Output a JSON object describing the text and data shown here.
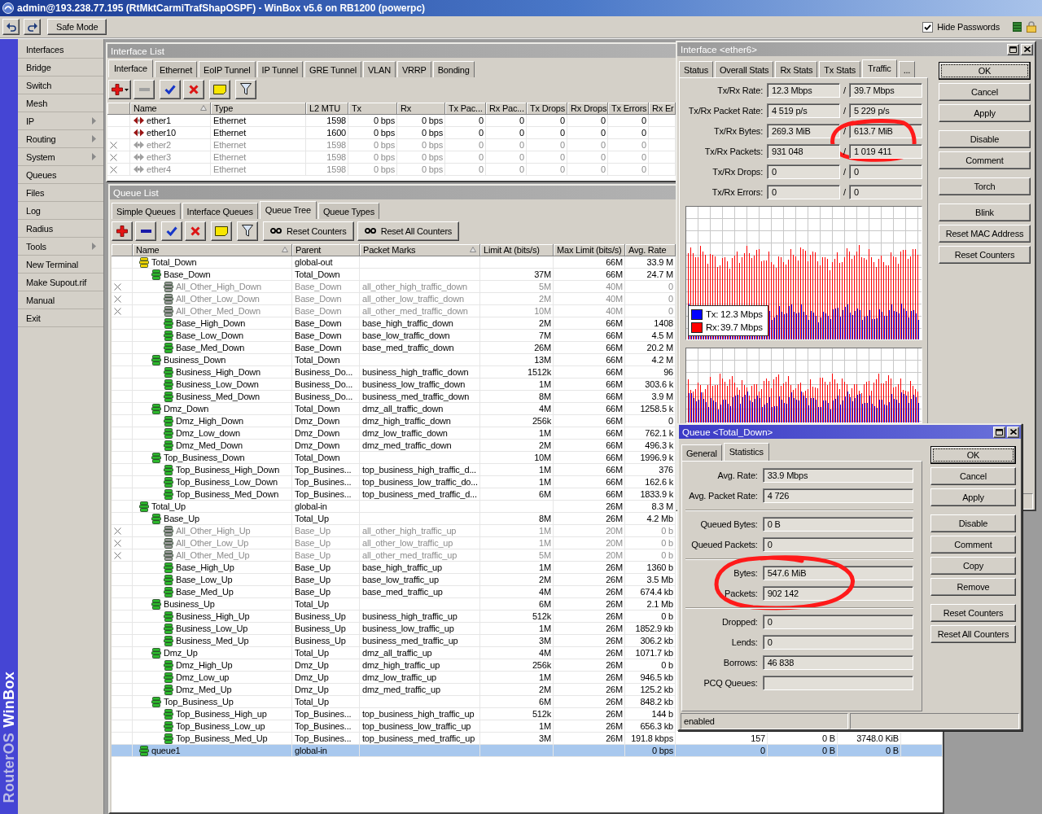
{
  "title_bar": {
    "title": "admin@193.238.77.195 (RtMktCarmiTrafShapOSPF) - WinBox v5.6 on RB1200 (powerpc)"
  },
  "toolbar": {
    "safe_mode": "Safe Mode",
    "hide_passwords": {
      "label": "Hide Passwords",
      "checked": true
    }
  },
  "side_strip": {
    "brand": "RouterOS",
    "product": "WinBox"
  },
  "sidebar": {
    "items": [
      {
        "label": "Interfaces",
        "submenu": false,
        "selected": false
      },
      {
        "label": "Bridge",
        "submenu": false,
        "selected": false
      },
      {
        "label": "Switch",
        "submenu": false,
        "selected": false
      },
      {
        "label": "Mesh",
        "submenu": false,
        "selected": false
      },
      {
        "label": "IP",
        "submenu": true,
        "selected": false
      },
      {
        "label": "Routing",
        "submenu": true,
        "selected": false
      },
      {
        "label": "System",
        "submenu": true,
        "selected": false
      },
      {
        "label": "Queues",
        "submenu": false,
        "selected": false
      },
      {
        "label": "Files",
        "submenu": false,
        "selected": false
      },
      {
        "label": "Log",
        "submenu": false,
        "selected": false
      },
      {
        "label": "Radius",
        "submenu": false,
        "selected": false
      },
      {
        "label": "Tools",
        "submenu": true,
        "selected": false
      },
      {
        "label": "New Terminal",
        "submenu": false,
        "selected": false
      },
      {
        "label": "Make Supout.rif",
        "submenu": false,
        "selected": false
      },
      {
        "label": "Manual",
        "submenu": false,
        "selected": false
      },
      {
        "label": "Exit",
        "submenu": false,
        "selected": false
      }
    ]
  },
  "interface_list": {
    "title": "Interface List",
    "tabs": [
      {
        "label": "Interface",
        "selected": true
      },
      {
        "label": "Ethernet",
        "selected": false
      },
      {
        "label": "EoIP Tunnel",
        "selected": false
      },
      {
        "label": "IP Tunnel",
        "selected": false
      },
      {
        "label": "GRE Tunnel",
        "selected": false
      },
      {
        "label": "VLAN",
        "selected": false
      },
      {
        "label": "VRRP",
        "selected": false
      },
      {
        "label": "Bonding",
        "selected": false
      }
    ],
    "tools": [
      {
        "kind": "add_menu",
        "disabled": false
      },
      {
        "kind": "remove",
        "disabled": true
      },
      {
        "kind": "enable",
        "disabled": false
      },
      {
        "kind": "disable",
        "disabled": false
      },
      {
        "kind": "comment",
        "disabled": false
      },
      {
        "kind": "filter",
        "disabled": false
      }
    ],
    "columns": [
      {
        "label": "Name",
        "sorted": true
      },
      {
        "label": "Type",
        "sorted": false
      },
      {
        "label": "L2 MTU",
        "sorted": false
      },
      {
        "label": "Tx",
        "sorted": false
      },
      {
        "label": "Rx",
        "sorted": false
      },
      {
        "label": "Tx Pac...",
        "sorted": false
      },
      {
        "label": "Rx Pac...",
        "sorted": false
      },
      {
        "label": "Tx Drops",
        "sorted": false
      },
      {
        "label": "Rx Drops",
        "sorted": false
      },
      {
        "label": "Tx Errors",
        "sorted": false
      },
      {
        "label": "Rx Er",
        "sorted": false
      }
    ],
    "rows": [
      {
        "disabled": false,
        "selected": false,
        "cells": [
          "ether1",
          "Ethernet",
          "1598",
          "0 bps",
          "0 bps",
          "0",
          "0",
          "0",
          "0",
          "0"
        ]
      },
      {
        "disabled": false,
        "selected": false,
        "cells": [
          "ether10",
          "Ethernet",
          "1600",
          "0 bps",
          "0 bps",
          "0",
          "0",
          "0",
          "0",
          "0"
        ]
      },
      {
        "disabled": true,
        "selected": false,
        "cells": [
          "ether2",
          "Ethernet",
          "1598",
          "0 bps",
          "0 bps",
          "0",
          "0",
          "0",
          "0",
          "0"
        ]
      },
      {
        "disabled": true,
        "selected": false,
        "cells": [
          "ether3",
          "Ethernet",
          "1598",
          "0 bps",
          "0 bps",
          "0",
          "0",
          "0",
          "0",
          "0"
        ]
      },
      {
        "disabled": true,
        "selected": false,
        "cells": [
          "ether4",
          "Ethernet",
          "1598",
          "0 bps",
          "0 bps",
          "0",
          "0",
          "0",
          "0",
          "0"
        ]
      }
    ]
  },
  "queue_list": {
    "title": "Queue List",
    "tabs": [
      {
        "label": "Simple Queues",
        "selected": false
      },
      {
        "label": "Interface Queues",
        "selected": false
      },
      {
        "label": "Queue Tree",
        "selected": true
      },
      {
        "label": "Queue Types",
        "selected": false
      }
    ],
    "tools": [
      {
        "kind": "add",
        "disabled": false
      },
      {
        "kind": "remove",
        "disabled": false
      },
      {
        "kind": "enable",
        "disabled": false
      },
      {
        "kind": "disable",
        "disabled": false
      },
      {
        "kind": "comment",
        "disabled": false
      },
      {
        "kind": "filter",
        "disabled": false
      },
      {
        "kind": "reset",
        "label": "Reset Counters",
        "disabled": false
      },
      {
        "kind": "reset",
        "label": "Reset All Counters",
        "disabled": false
      }
    ],
    "columns": [
      {
        "label": "Name",
        "sorted": true
      },
      {
        "label": "Parent",
        "sorted": false
      },
      {
        "label": "Packet Marks",
        "sorted": true
      },
      {
        "label": "Limit At (bits/s)",
        "sorted": false
      },
      {
        "label": "Max Limit (bits/s)",
        "sorted": false
      },
      {
        "label": "Avg. Rate",
        "sorted": false
      }
    ],
    "rows": [
      {
        "name": "Total_Down",
        "parent": "global-out",
        "max_limit": "66M",
        "avg_rate": "33.9 M",
        "disabled": false,
        "selected": false,
        "color": "#f2d600",
        "children": [
          {
            "name": "Base_Down",
            "parent": "Total_Down",
            "limit_at": "37M",
            "max_limit": "66M",
            "avg_rate": "24.7 M",
            "disabled": false,
            "selected": false,
            "color": "#2cb82c",
            "children": [
              {
                "name": "All_Other_High_Down",
                "parent": "Base_Down",
                "packet_marks": "all_other_high_traffic_down",
                "limit_at": "5M",
                "max_limit": "40M",
                "avg_rate": "0",
                "disabled": true,
                "selected": false,
                "color": "#9c9c9c"
              },
              {
                "name": "All_Other_Low_Down",
                "parent": "Base_Down",
                "packet_marks": "all_other_low_traffic_down",
                "limit_at": "2M",
                "max_limit": "40M",
                "avg_rate": "0",
                "disabled": true,
                "selected": false,
                "color": "#9c9c9c"
              },
              {
                "name": "All_Other_Med_Down",
                "parent": "Base_Down",
                "packet_marks": "all_other_med_traffic_down",
                "limit_at": "10M",
                "max_limit": "40M",
                "avg_rate": "0",
                "disabled": true,
                "selected": false,
                "color": "#9c9c9c"
              },
              {
                "name": "Base_High_Down",
                "parent": "Base_Down",
                "packet_marks": "base_high_traffic_down",
                "limit_at": "2M",
                "max_limit": "66M",
                "avg_rate": "1408",
                "disabled": false,
                "selected": false,
                "color": "#2cb82c"
              },
              {
                "name": "Base_Low_Down",
                "parent": "Base_Down",
                "packet_marks": "base_low_traffic_down",
                "limit_at": "7M",
                "max_limit": "66M",
                "avg_rate": "4.5 M",
                "disabled": false,
                "selected": false,
                "color": "#2cb82c"
              },
              {
                "name": "Base_Med_Down",
                "parent": "Base_Down",
                "packet_marks": "base_med_traffic_down",
                "limit_at": "26M",
                "max_limit": "66M",
                "avg_rate": "20.2 M",
                "disabled": false,
                "selected": false,
                "color": "#2cb82c"
              }
            ]
          },
          {
            "name": "Business_Down",
            "parent": "Total_Down",
            "limit_at": "13M",
            "max_limit": "66M",
            "avg_rate": "4.2 M",
            "disabled": false,
            "selected": false,
            "color": "#2cb82c",
            "children": [
              {
                "name": "Business_High_Down",
                "parent": "Business_Do...",
                "packet_marks": "business_high_traffic_down",
                "limit_at": "1512k",
                "max_limit": "66M",
                "avg_rate": "96",
                "disabled": false,
                "selected": false,
                "color": "#2cb82c"
              },
              {
                "name": "Business_Low_Down",
                "parent": "Business_Do...",
                "packet_marks": "business_low_traffic_down",
                "limit_at": "1M",
                "max_limit": "66M",
                "avg_rate": "303.6 k",
                "disabled": false,
                "selected": false,
                "color": "#2cb82c"
              },
              {
                "name": "Business_Med_Down",
                "parent": "Business_Do...",
                "packet_marks": "business_med_traffic_down",
                "limit_at": "8M",
                "max_limit": "66M",
                "avg_rate": "3.9 M",
                "disabled": false,
                "selected": false,
                "color": "#2cb82c"
              }
            ]
          },
          {
            "name": "Dmz_Down",
            "parent": "Total_Down",
            "packet_marks": "dmz_all_traffic_down",
            "limit_at": "4M",
            "max_limit": "66M",
            "avg_rate": "1258.5 k",
            "disabled": false,
            "selected": false,
            "color": "#2cb82c",
            "children": [
              {
                "name": "Dmz_High_Down",
                "parent": "Dmz_Down",
                "packet_marks": "dmz_high_traffic_down",
                "limit_at": "256k",
                "max_limit": "66M",
                "avg_rate": "0",
                "disabled": false,
                "selected": false,
                "color": "#2cb82c"
              },
              {
                "name": "Dmz_Low_down",
                "parent": "Dmz_Down",
                "packet_marks": "dmz_low_traffic_down",
                "limit_at": "1M",
                "max_limit": "66M",
                "avg_rate": "762.1 k",
                "disabled": false,
                "selected": false,
                "color": "#2cb82c"
              },
              {
                "name": "Dmz_Med_Down",
                "parent": "Dmz_Down",
                "packet_marks": "dmz_med_traffic_down",
                "limit_at": "2M",
                "max_limit": "66M",
                "avg_rate": "496.3 k",
                "disabled": false,
                "selected": false,
                "color": "#2cb82c"
              }
            ]
          },
          {
            "name": "Top_Business_Down",
            "parent": "Total_Down",
            "limit_at": "10M",
            "max_limit": "66M",
            "avg_rate": "1996.9 k",
            "disabled": false,
            "selected": false,
            "color": "#2cb82c",
            "children": [
              {
                "name": "Top_Business_High_Down",
                "parent": "Top_Busines...",
                "packet_marks": "top_business_high_traffic_d...",
                "limit_at": "1M",
                "max_limit": "66M",
                "avg_rate": "376",
                "disabled": false,
                "selected": false,
                "color": "#2cb82c"
              },
              {
                "name": "Top_Business_Low_Down",
                "parent": "Top_Busines...",
                "packet_marks": "top_business_low_traffic_do...",
                "limit_at": "1M",
                "max_limit": "66M",
                "avg_rate": "162.6 k",
                "disabled": false,
                "selected": false,
                "color": "#2cb82c"
              },
              {
                "name": "Top_Business_Med_Down",
                "parent": "Top_Busines...",
                "packet_marks": "top_business_med_traffic_d...",
                "limit_at": "6M",
                "max_limit": "66M",
                "avg_rate": "1833.9 k",
                "disabled": false,
                "selected": false,
                "color": "#2cb82c"
              }
            ]
          }
        ]
      },
      {
        "name": "Total_Up",
        "parent": "global-in",
        "max_limit": "26M",
        "avg_rate": "8.3 M",
        "disabled": false,
        "selected": false,
        "color": "#2cb82c",
        "children": [
          {
            "name": "Base_Up",
            "parent": "Total_Up",
            "limit_at": "8M",
            "max_limit": "26M",
            "avg_rate": "4.2 Mb",
            "disabled": false,
            "selected": false,
            "color": "#2cb82c",
            "children": [
              {
                "name": "All_Other_High_Up",
                "parent": "Base_Up",
                "packet_marks": "all_other_high_traffic_up",
                "limit_at": "1M",
                "max_limit": "20M",
                "avg_rate": "0 b",
                "disabled": true,
                "selected": false,
                "color": "#9c9c9c"
              },
              {
                "name": "All_Other_Low_Up",
                "parent": "Base_Up",
                "packet_marks": "all_other_low_traffic_up",
                "limit_at": "1M",
                "max_limit": "20M",
                "avg_rate": "0 b",
                "disabled": true,
                "selected": false,
                "color": "#9c9c9c"
              },
              {
                "name": "All_Other_Med_Up",
                "parent": "Base_Up",
                "packet_marks": "all_other_med_traffic_up",
                "limit_at": "5M",
                "max_limit": "20M",
                "avg_rate": "0 b",
                "disabled": true,
                "selected": false,
                "color": "#9c9c9c"
              },
              {
                "name": "Base_High_Up",
                "parent": "Base_Up",
                "packet_marks": "base_high_traffic_up",
                "limit_at": "1M",
                "max_limit": "26M",
                "avg_rate": "1360 b",
                "disabled": false,
                "selected": false,
                "color": "#2cb82c"
              },
              {
                "name": "Base_Low_Up",
                "parent": "Base_Up",
                "packet_marks": "base_low_traffic_up",
                "limit_at": "2M",
                "max_limit": "26M",
                "avg_rate": "3.5 Mb",
                "disabled": false,
                "selected": false,
                "color": "#2cb82c"
              },
              {
                "name": "Base_Med_Up",
                "parent": "Base_Up",
                "packet_marks": "base_med_traffic_up",
                "limit_at": "4M",
                "max_limit": "26M",
                "avg_rate": "674.4 kb",
                "disabled": false,
                "selected": false,
                "color": "#2cb82c"
              }
            ]
          },
          {
            "name": "Business_Up",
            "parent": "Total_Up",
            "limit_at": "6M",
            "max_limit": "26M",
            "avg_rate": "2.1 Mb",
            "disabled": false,
            "selected": false,
            "color": "#2cb82c",
            "children": [
              {
                "name": "Business_High_Up",
                "parent": "Business_Up",
                "packet_marks": "business_high_traffic_up",
                "limit_at": "512k",
                "max_limit": "26M",
                "avg_rate": "0 b",
                "disabled": false,
                "selected": false,
                "color": "#2cb82c"
              },
              {
                "name": "Business_Low_Up",
                "parent": "Business_Up",
                "packet_marks": "business_low_traffic_up",
                "limit_at": "1M",
                "max_limit": "26M",
                "avg_rate": "1852.9 kb",
                "disabled": false,
                "selected": false,
                "color": "#2cb82c"
              },
              {
                "name": "Business_Med_Up",
                "parent": "Business_Up",
                "packet_marks": "business_med_traffic_up",
                "limit_at": "3M",
                "max_limit": "26M",
                "avg_rate": "306.2 kb",
                "disabled": false,
                "selected": false,
                "color": "#2cb82c"
              }
            ]
          },
          {
            "name": "Dmz_Up",
            "parent": "Total_Up",
            "packet_marks": "dmz_all_traffic_up",
            "limit_at": "4M",
            "max_limit": "26M",
            "avg_rate": "1071.7 kb",
            "disabled": false,
            "selected": false,
            "color": "#2cb82c",
            "children": [
              {
                "name": "Dmz_High_Up",
                "parent": "Dmz_Up",
                "packet_marks": "dmz_high_traffic_up",
                "limit_at": "256k",
                "max_limit": "26M",
                "avg_rate": "0 b",
                "disabled": false,
                "selected": false,
                "color": "#2cb82c"
              },
              {
                "name": "Dmz_Low_up",
                "parent": "Dmz_Up",
                "packet_marks": "dmz_low_traffic_up",
                "limit_at": "1M",
                "max_limit": "26M",
                "avg_rate": "946.5 kb",
                "disabled": false,
                "selected": false,
                "color": "#2cb82c"
              },
              {
                "name": "Dmz_Med_Up",
                "parent": "Dmz_Up",
                "packet_marks": "dmz_med_traffic_up",
                "limit_at": "2M",
                "max_limit": "26M",
                "avg_rate": "125.2 kb",
                "disabled": false,
                "selected": false,
                "color": "#2cb82c"
              }
            ]
          },
          {
            "name": "Top_Business_Up",
            "parent": "Total_Up",
            "limit_at": "6M",
            "max_limit": "26M",
            "avg_rate": "848.2 kb",
            "disabled": false,
            "selected": false,
            "color": "#2cb82c",
            "children": [
              {
                "name": "Top_Business_High_up",
                "parent": "Top_Busines...",
                "packet_marks": "top_business_high_traffic_up",
                "limit_at": "512k",
                "max_limit": "26M",
                "avg_rate": "144 b",
                "disabled": false,
                "selected": false,
                "color": "#2cb82c"
              },
              {
                "name": "Top_Business_Low_up",
                "parent": "Top_Busines...",
                "packet_marks": "top_business_low_traffic_up",
                "limit_at": "1M",
                "max_limit": "26M",
                "avg_rate": "656.3 kb",
                "disabled": false,
                "selected": false,
                "color": "#2cb82c"
              },
              {
                "name": "Top_Business_Med_Up",
                "parent": "Top_Busines...",
                "packet_marks": "top_business_med_traffic_up",
                "limit_at": "3M",
                "max_limit": "26M",
                "avg_rate": "191.8 kbps",
                "column_8": "157",
                "column_9": "0 B",
                "column_10": "3748.0 KiB",
                "disabled": false,
                "selected": false,
                "color": "#2cb82c"
              }
            ]
          }
        ]
      },
      {
        "name": "queue1",
        "parent": "global-in",
        "avg_rate": "0 bps",
        "column_8": "0",
        "column_9": "0 B",
        "column_10": "0 B",
        "disabled": false,
        "selected": true,
        "color": "#2cb82c"
      }
    ]
  },
  "interface_window": {
    "title": "Interface <ether6>",
    "tabs": [
      {
        "label": "Status",
        "selected": false
      },
      {
        "label": "Overall Stats",
        "selected": false
      },
      {
        "label": "Rx Stats",
        "selected": false
      },
      {
        "label": "Tx Stats",
        "selected": false
      },
      {
        "label": "Traffic",
        "selected": true
      },
      {
        "label": "...",
        "selected": false
      }
    ],
    "stats": [
      {
        "label": "Tx/Rx Rate:",
        "tx": "12.3 Mbps",
        "separator": "/",
        "rx": "39.7 Mbps",
        "circled": false
      },
      {
        "label": "Tx/Rx Packet Rate:",
        "tx": "4 519 p/s",
        "separator": "/",
        "rx": "5 229 p/s",
        "circled": false
      },
      {
        "label": "Tx/Rx Bytes:",
        "tx": "269.3 MiB",
        "separator": "/",
        "rx": "613.7 MiB",
        "circled": true
      },
      {
        "label": "Tx/Rx Packets:",
        "tx": "931 048",
        "separator": "/",
        "rx": "1 019 411",
        "circled": true
      },
      {
        "label": "Tx/Rx Drops:",
        "tx": "0",
        "separator": "/",
        "rx": "0",
        "circled": false
      },
      {
        "label": "Tx/Rx Errors:",
        "tx": "0",
        "separator": "/",
        "rx": "0",
        "circled": false
      }
    ],
    "graph": {
      "legend": [
        {
          "label": "Tx:",
          "value": "12.3 Mbps",
          "color": "#0000ff"
        },
        {
          "label": "Rx:",
          "value": "39.7 Mbps",
          "color": "#ff0000"
        }
      ]
    },
    "button_groups": [
      [
        {
          "label": "OK",
          "focused": true
        },
        {
          "label": "Cancel",
          "focused": false
        },
        {
          "label": "Apply",
          "focused": false
        }
      ],
      [
        {
          "label": "Disable",
          "focused": false
        },
        {
          "label": "Comment",
          "focused": false
        }
      ],
      [
        {
          "label": "Torch",
          "focused": false
        }
      ],
      [
        {
          "label": "Blink",
          "focused": false
        },
        {
          "label": "Reset MAC Address",
          "focused": false
        },
        {
          "label": "Reset Counters",
          "focused": false
        }
      ]
    ]
  },
  "queue_window": {
    "title": "Queue <Total_Down>",
    "tabs": [
      {
        "label": "General",
        "selected": false
      },
      {
        "label": "Statistics",
        "selected": true
      }
    ],
    "sections": [
      {
        "circled": false,
        "fields": [
          {
            "label": "Avg. Rate:",
            "value": "33.9 Mbps"
          },
          {
            "label": "Avg. Packet Rate:",
            "value": "4 726"
          }
        ]
      },
      {
        "circled": false,
        "fields": [
          {
            "label": "Queued Bytes:",
            "value": "0 B"
          },
          {
            "label": "Queued Packets:",
            "value": "0"
          }
        ]
      },
      {
        "circled": true,
        "fields": [
          {
            "label": "Bytes:",
            "value": "547.6 MiB"
          },
          {
            "label": "Packets:",
            "value": "902 142"
          }
        ]
      },
      {
        "circled": false,
        "fields": [
          {
            "label": "Dropped:",
            "value": "0"
          },
          {
            "label": "Lends:",
            "value": "0"
          },
          {
            "label": "Borrows:",
            "value": "46 838"
          },
          {
            "label": "PCQ Queues:"
          }
        ]
      }
    ],
    "button_groups": [
      [
        {
          "label": "OK",
          "focused": true
        },
        {
          "label": "Cancel",
          "focused": false
        },
        {
          "label": "Apply",
          "focused": false
        }
      ],
      [
        {
          "label": "Disable",
          "focused": false
        },
        {
          "label": "Comment",
          "focused": false
        },
        {
          "label": "Copy",
          "focused": false
        },
        {
          "label": "Remove",
          "focused": false
        }
      ],
      [
        {
          "label": "Reset Counters",
          "focused": false
        },
        {
          "label": "Reset All Counters",
          "focused": false
        }
      ]
    ],
    "status_bar": {
      "state": "enabled"
    }
  }
}
